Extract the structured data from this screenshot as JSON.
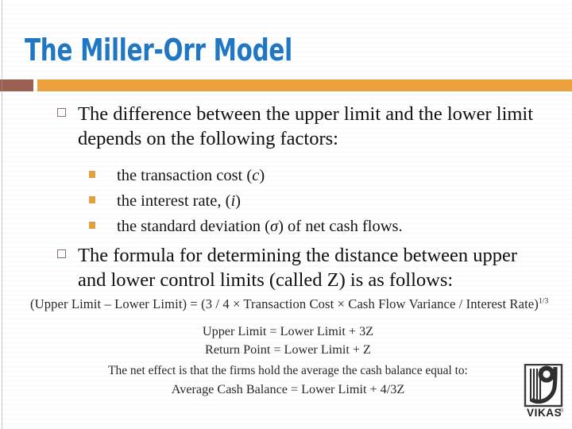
{
  "slide": {
    "title": "The Miller-Orr Model",
    "title_color": "#1f77c4",
    "accent_bar_brown": "#9a5f51",
    "accent_bar_orange": "#eda13a",
    "background_color": "#ffffff"
  },
  "body": {
    "bullets": [
      {
        "level": 1,
        "text": "The difference between the upper limit and the lower limit depends on the following factors:"
      },
      {
        "level": 2,
        "text_before": "the transaction cost (",
        "symbol": "c",
        "text_after": ")"
      },
      {
        "level": 2,
        "text_before": "the interest rate, (",
        "symbol": "i",
        "text_after": ")"
      },
      {
        "level": 2,
        "text_before": "the standard deviation (",
        "symbol": "σ",
        "text_after": ") of net cash flows."
      },
      {
        "level": 1,
        "text": "The formula for determining the distance between upper and lower control limits (called Z) is as follows:"
      }
    ],
    "bullet_marker_level1": "hollow-square",
    "bullet_marker_level2": "filled-square",
    "bullet_marker_level2_color": "#e0a33c"
  },
  "formula": {
    "main_equation": "(Upper Limit – Lower Limit) = (3 / 4 × Transaction Cost × Cash Flow Variance / Interest Rate)",
    "main_exponent": "1/3",
    "line1": "Upper Limit = Lower Limit + 3Z",
    "line2": "Return Point = Lower Limit + Z",
    "line3": "The net effect is that the firms hold the average the cash balance equal to:",
    "line4": "Average Cash Balance = Lower Limit + 4/3Z"
  },
  "logo": {
    "brand": "VIKAS",
    "trademark": "®"
  }
}
